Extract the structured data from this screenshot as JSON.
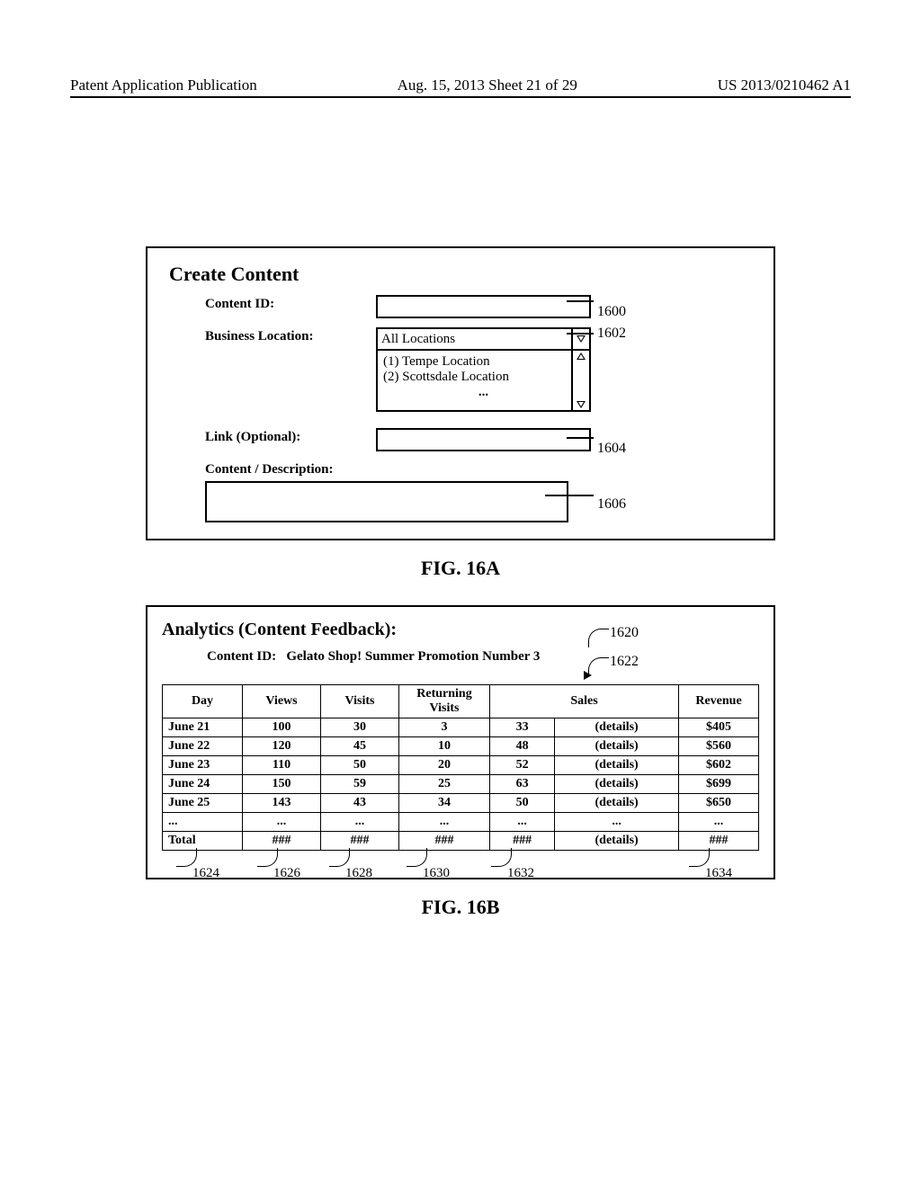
{
  "header": {
    "left": "Patent Application Publication",
    "center": "Aug. 15, 2013  Sheet 21 of 29",
    "right": "US 2013/0210462 A1"
  },
  "fig16a": {
    "title": "Create Content",
    "labels": {
      "contentId": "Content ID:",
      "businessLocation": "Business Location:",
      "link": "Link (Optional):",
      "description": "Content / Description:"
    },
    "dropdown": {
      "selected": "All Locations",
      "option1": "(1) Tempe Location",
      "option2": "(2) Scottsdale Location",
      "more": "..."
    },
    "callouts": {
      "c1": "1600",
      "c2": "1602",
      "c3": "1604",
      "c4": "1606"
    },
    "caption": "FIG. 16A"
  },
  "fig16b": {
    "title": "Analytics (Content Feedback):",
    "subLabel": "Content ID:",
    "subValue": "Gelato Shop! Summer Promotion Number 3",
    "callouts": {
      "c1620": "1620",
      "c1622": "1622",
      "c1624": "1624",
      "c1626": "1626",
      "c1628": "1628",
      "c1630": "1630",
      "c1632": "1632",
      "c1634": "1634"
    },
    "headers": {
      "day": "Day",
      "views": "Views",
      "visits": "Visits",
      "returning": "Returning Visits",
      "sales": "Sales",
      "revenue": "Revenue"
    },
    "rows": [
      {
        "day": "June 21",
        "views": "100",
        "visits": "30",
        "returning": "3",
        "sales": "33",
        "details": "(details)",
        "revenue": "$405"
      },
      {
        "day": "June 22",
        "views": "120",
        "visits": "45",
        "returning": "10",
        "sales": "48",
        "details": "(details)",
        "revenue": "$560"
      },
      {
        "day": "June 23",
        "views": "110",
        "visits": "50",
        "returning": "20",
        "sales": "52",
        "details": "(details)",
        "revenue": "$602"
      },
      {
        "day": "June 24",
        "views": "150",
        "visits": "59",
        "returning": "25",
        "sales": "63",
        "details": "(details)",
        "revenue": "$699"
      },
      {
        "day": "June 25",
        "views": "143",
        "visits": "43",
        "returning": "34",
        "sales": "50",
        "details": "(details)",
        "revenue": "$650"
      },
      {
        "day": "...",
        "views": "...",
        "visits": "...",
        "returning": "...",
        "sales": "...",
        "details": "...",
        "revenue": "..."
      },
      {
        "day": "Total",
        "views": "###",
        "visits": "###",
        "returning": "###",
        "sales": "###",
        "details": "(details)",
        "revenue": "###"
      }
    ],
    "caption": "FIG. 16B"
  }
}
